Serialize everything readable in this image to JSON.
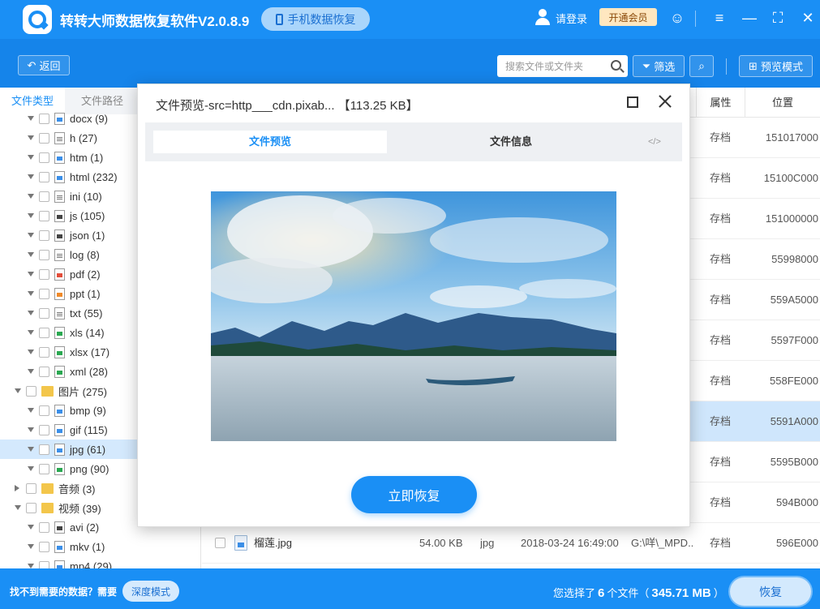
{
  "app": {
    "title": "转转大师数据恢复软件V2.0.8.9",
    "phone_recovery": "手机数据恢复",
    "login": "请登录",
    "vip": "开通会员"
  },
  "toolbar": {
    "back": "返回",
    "search_placeholder": "搜索文件或文件夹",
    "filter": "筛选",
    "preview_mode": "预览模式"
  },
  "sidebar": {
    "tab_type": "文件类型",
    "tab_path": "文件路径",
    "items": [
      {
        "label": "docx (9)",
        "icon": "blue",
        "level": 1
      },
      {
        "label": "h (27)",
        "icon": "gray",
        "level": 1
      },
      {
        "label": "htm (1)",
        "icon": "blue",
        "level": 1
      },
      {
        "label": "html (232)",
        "icon": "blue",
        "level": 1
      },
      {
        "label": "ini (10)",
        "icon": "gray",
        "level": 1
      },
      {
        "label": "js (105)",
        "icon": "dark",
        "level": 1
      },
      {
        "label": "json (1)",
        "icon": "dark",
        "level": 1
      },
      {
        "label": "log (8)",
        "icon": "gray",
        "level": 1
      },
      {
        "label": "pdf (2)",
        "icon": "red",
        "level": 1
      },
      {
        "label": "ppt (1)",
        "icon": "orange",
        "level": 1
      },
      {
        "label": "txt (55)",
        "icon": "gray",
        "level": 1
      },
      {
        "label": "xls (14)",
        "icon": "green",
        "level": 1
      },
      {
        "label": "xlsx (17)",
        "icon": "green",
        "level": 1
      },
      {
        "label": "xml (28)",
        "icon": "green",
        "level": 1
      },
      {
        "label": "图片 (275)",
        "icon": "folder",
        "level": 0,
        "expanded": true
      },
      {
        "label": "bmp (9)",
        "icon": "blue",
        "level": 1
      },
      {
        "label": "gif (115)",
        "icon": "blue",
        "level": 1
      },
      {
        "label": "jpg (61)",
        "icon": "blue",
        "level": 1,
        "selected": true
      },
      {
        "label": "png (90)",
        "icon": "green",
        "level": 1
      },
      {
        "label": "音频 (3)",
        "icon": "folder",
        "level": 0,
        "expanded": false
      },
      {
        "label": "视频 (39)",
        "icon": "folder",
        "level": 0,
        "expanded": true
      },
      {
        "label": "avi (2)",
        "icon": "dark",
        "level": 1
      },
      {
        "label": "mkv (1)",
        "icon": "blue",
        "level": 1
      },
      {
        "label": "mp4 (29)",
        "icon": "blue",
        "level": 1
      }
    ]
  },
  "table": {
    "headers": {
      "attr": "属性",
      "location": "位置"
    },
    "rows": [
      {
        "attr": "存档",
        "location": "151017000"
      },
      {
        "attr": "存档",
        "location": "15100C000"
      },
      {
        "attr": "存档",
        "location": "151000000"
      },
      {
        "attr": "存档",
        "location": "55998000"
      },
      {
        "attr": "存档",
        "location": "559A5000"
      },
      {
        "attr": "存档",
        "location": "5597F000"
      },
      {
        "attr": "存档",
        "location": "558FE000"
      },
      {
        "attr": "存档",
        "location": "5591A000",
        "selected": true
      },
      {
        "attr": "存档",
        "location": "5595B000"
      },
      {
        "attr": "存档",
        "location": "594B000"
      },
      {
        "name": "榴莲.jpg",
        "size": "54.00 KB",
        "type": "jpg",
        "date": "2018-03-24 16:49:00",
        "path": "G:\\咩\\_MPD...",
        "attr": "存档",
        "location": "596E000"
      }
    ]
  },
  "bottom": {
    "help": "找不到需要的数据？需要",
    "deep_mode": "深度模式",
    "selected_prefix": "您选择了",
    "selected_count": "6",
    "selected_mid": "个文件（",
    "selected_size": "345.71 MB",
    "selected_suffix": "）",
    "recover": "恢复"
  },
  "dialog": {
    "title": "文件预览-src=http___cdn.pixab... 【113.25 KB】",
    "tab_preview": "文件预览",
    "tab_info": "文件信息",
    "code_icon": "</>",
    "recover_now": "立即恢复"
  }
}
